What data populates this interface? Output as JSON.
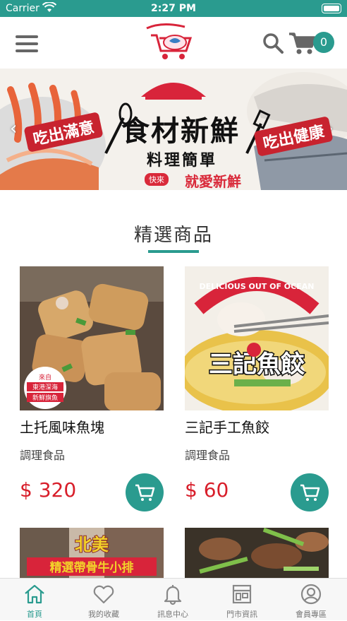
{
  "status_bar": {
    "carrier": "Carrier",
    "time": "2:27 PM"
  },
  "header": {
    "cart_count": "0"
  },
  "banner": {
    "title": "食材新鮮",
    "subtitle": "料理簡單",
    "small_tag": "快來",
    "tagline": "就愛新鮮",
    "left_text": "吃出滿意",
    "right_text": "吃出健康"
  },
  "section": {
    "title": "精選商品"
  },
  "products": [
    {
      "name": "土托風味魚塊",
      "category": "調理食品",
      "price": "$ 320"
    },
    {
      "name": "三記手工魚餃",
      "category": "調理食品",
      "price": "$ 60"
    }
  ],
  "tabs": [
    {
      "label": "首頁",
      "icon": "home-icon"
    },
    {
      "label": "我的收藏",
      "icon": "heart-icon"
    },
    {
      "label": "訊息中心",
      "icon": "bell-icon"
    },
    {
      "label": "門市資訊",
      "icon": "store-icon"
    },
    {
      "label": "會員專區",
      "icon": "user-icon"
    }
  ],
  "colors": {
    "accent": "#2a9b8f",
    "price": "#d81e2a",
    "banner_red": "#c8232f"
  }
}
